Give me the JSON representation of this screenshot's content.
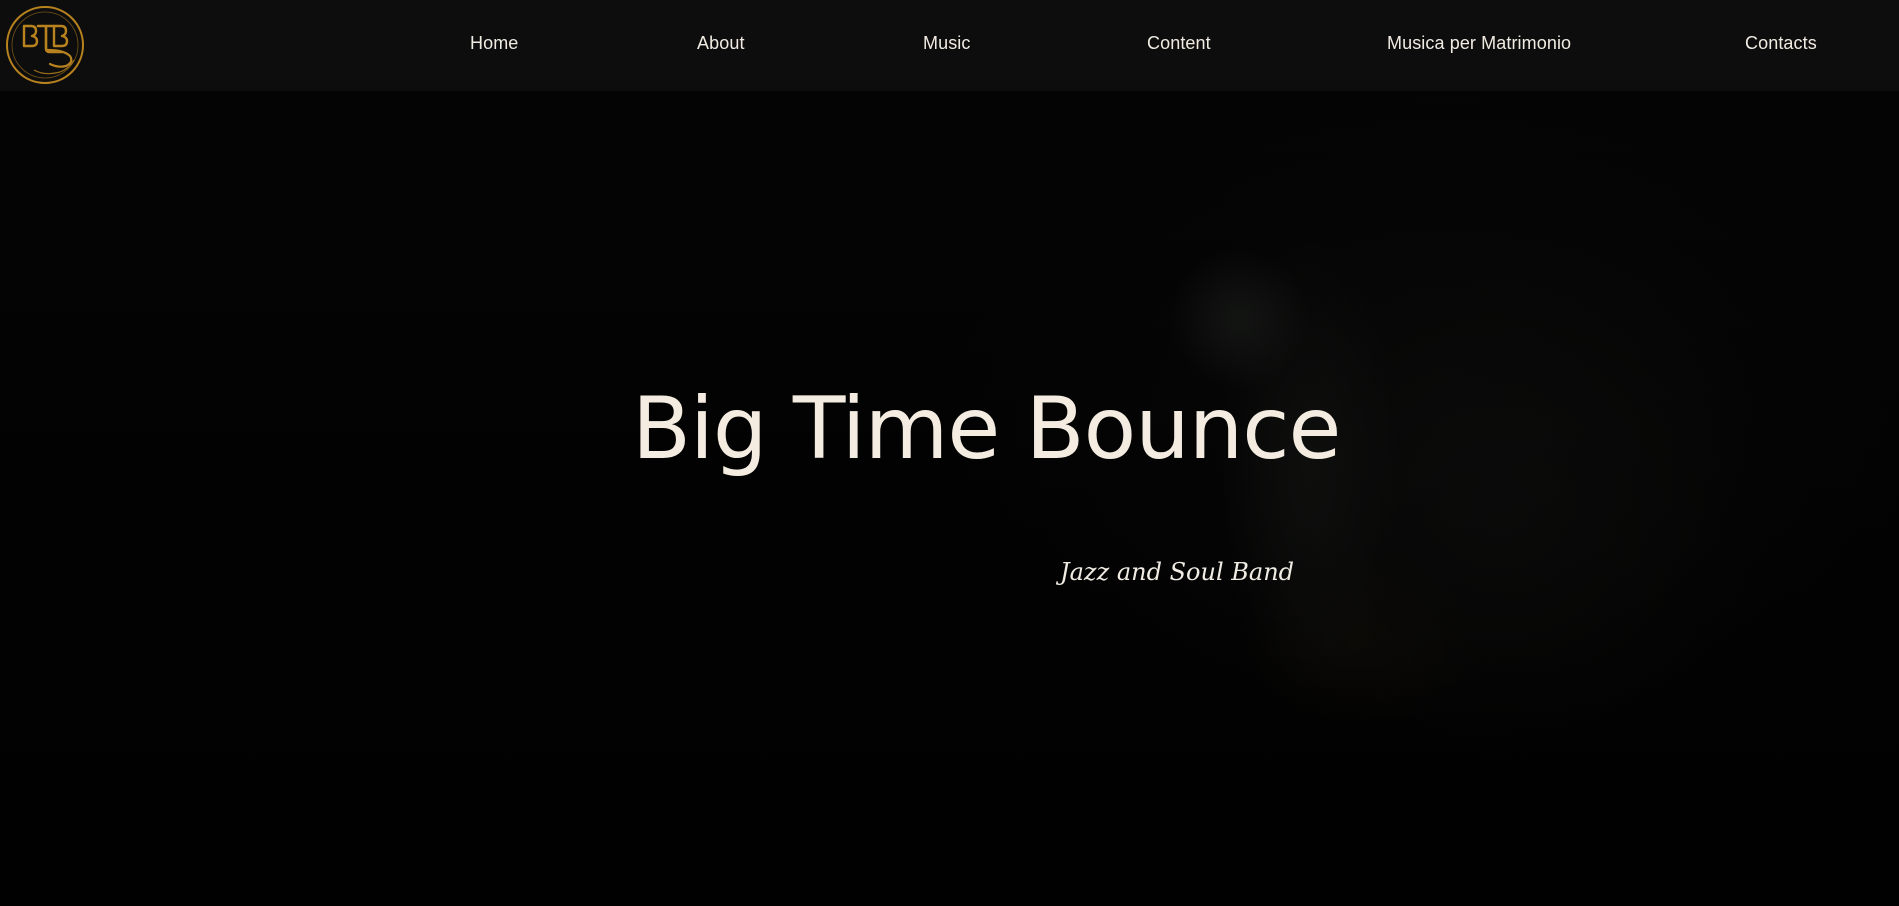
{
  "brand": {
    "logo_text": "BTB",
    "logo_ring_text": "Jazz & Soul Band",
    "accent_color": "#b8831f"
  },
  "nav": {
    "items": [
      {
        "label": "Home"
      },
      {
        "label": "About"
      },
      {
        "label": "Music"
      },
      {
        "label": "Content"
      },
      {
        "label": "Musica per Matrimonio"
      },
      {
        "label": "Contacts"
      }
    ]
  },
  "hero": {
    "title": "Big Time Bounce",
    "subtitle": "Jazz and Soul Band"
  },
  "colors": {
    "background": "#020202",
    "header": "#0d0d0d",
    "text": "#f1ece3"
  }
}
